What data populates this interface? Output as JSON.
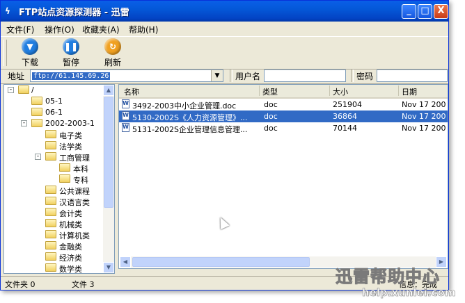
{
  "window": {
    "title": "FTP站点资源探测器 - 迅雷",
    "app_icon": "thunder-icon",
    "min_glyph": "_",
    "max_glyph": "□",
    "close_glyph": "X"
  },
  "menu": {
    "items": [
      {
        "label": "文件(F)"
      },
      {
        "label": "操作(O)"
      },
      {
        "label": "收藏夹(A)"
      },
      {
        "label": "帮助(H)"
      }
    ]
  },
  "toolbar": {
    "download_label": "下载",
    "pause_label": "暂停",
    "refresh_label": "刷新",
    "download_icon": "download-icon",
    "pause_icon": "pause-icon",
    "refresh_icon": "refresh-icon"
  },
  "address": {
    "label": "地址",
    "value": "ftp://61.145.69.26",
    "user_label": "用户名",
    "user_value": "",
    "password_label": "密码",
    "password_value": ""
  },
  "tree": {
    "nodes": [
      {
        "label": "/",
        "expander": "-"
      },
      {
        "label": "05-1",
        "expander": ""
      },
      {
        "label": "06-1",
        "expander": ""
      },
      {
        "label": "2002-2003-1",
        "expander": "-"
      },
      {
        "label": "电子类",
        "expander": ""
      },
      {
        "label": "法学类",
        "expander": ""
      },
      {
        "label": "工商管理",
        "expander": "-"
      },
      {
        "label": "本科",
        "expander": ""
      },
      {
        "label": "专科",
        "expander": ""
      },
      {
        "label": "公共课程",
        "expander": ""
      },
      {
        "label": "汉语言类",
        "expander": ""
      },
      {
        "label": "会计类",
        "expander": ""
      },
      {
        "label": "机械类",
        "expander": ""
      },
      {
        "label": "计算机类",
        "expander": ""
      },
      {
        "label": "金融类",
        "expander": ""
      },
      {
        "label": "经济类",
        "expander": ""
      },
      {
        "label": "数学类",
        "expander": ""
      }
    ]
  },
  "file_list": {
    "columns": [
      "名称",
      "类型",
      "大小",
      "日期"
    ],
    "rows": [
      {
        "name": "3492-2003中小企业管理.doc",
        "type": "doc",
        "size": "251904",
        "date": "Nov 17  200",
        "selected": false
      },
      {
        "name": "5130-2002S《人力资源管理》...",
        "type": "doc",
        "size": "36864",
        "date": "Nov 17  200",
        "selected": true
      },
      {
        "name": "5131-2002S企业管理信息管理...",
        "type": "doc",
        "size": "70144",
        "date": "Nov 17  200",
        "selected": false
      }
    ]
  },
  "status": {
    "folders": "文件夹 0",
    "files": "文件 3",
    "info": "信息：完成"
  },
  "watermark": {
    "text": "迅雷帮助中心",
    "url": "help.xunlei.com"
  },
  "colors": {
    "title_bar": "#0458d8",
    "selection": "#316ac5",
    "download_icon": "#1f7de0",
    "pause_icon": "#1f7de0",
    "refresh_icon": "#f0a020"
  }
}
